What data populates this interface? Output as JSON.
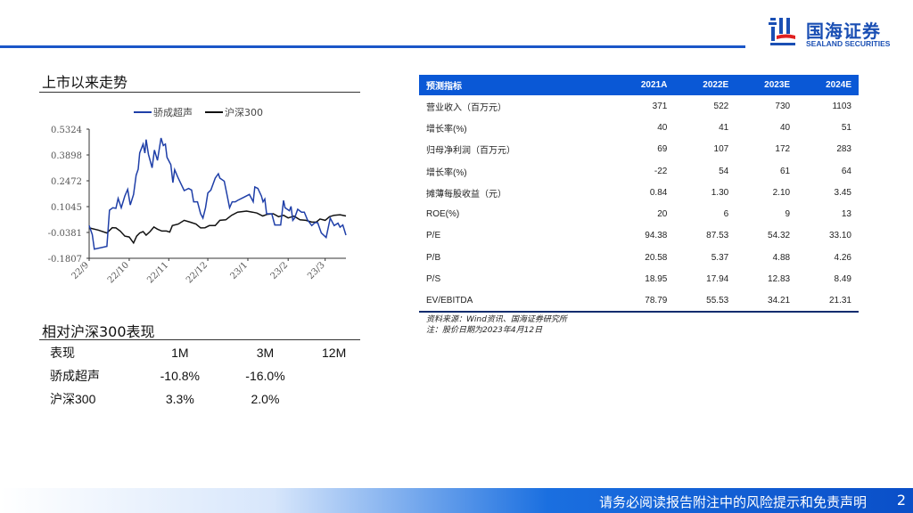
{
  "header": {
    "logo_cn": "国海证券",
    "logo_en": "SEALAND SECURITIES",
    "accent": "#1a56c8"
  },
  "trend": {
    "title": "上市以来走势"
  },
  "chart_data": {
    "type": "line",
    "title": "",
    "legend": [
      "骄成超声",
      "沪深300"
    ],
    "legend_position": "top",
    "yticks": [
      "0.5324",
      "0.3898",
      "0.2472",
      "0.1045",
      "-0.0381",
      "-0.1807"
    ],
    "ylim": [
      -0.1807,
      0.5324
    ],
    "xlim": [
      0,
      100
    ],
    "xticks": [
      {
        "label": "22/9",
        "t": 0
      },
      {
        "label": "22/10",
        "t": 15.6
      },
      {
        "label": "22/11",
        "t": 31
      },
      {
        "label": "22/12",
        "t": 46.2
      },
      {
        "label": "23/1",
        "t": 61.8
      },
      {
        "label": "23/2",
        "t": 77.5
      },
      {
        "label": "23/3",
        "t": 91.9
      }
    ],
    "series": [
      {
        "name": "骄成超声",
        "color": "#1f3fa8",
        "points": [
          [
            0,
            0
          ],
          [
            1.2,
            -0.05
          ],
          [
            2,
            -0.13
          ],
          [
            6.9,
            -0.115
          ],
          [
            7.9,
            0.085
          ],
          [
            9.2,
            0.098
          ],
          [
            10.4,
            0.095
          ],
          [
            11.3,
            0.15
          ],
          [
            12.5,
            0.098
          ],
          [
            13.9,
            0.163
          ],
          [
            15,
            0.2
          ],
          [
            16,
            0.114
          ],
          [
            17.3,
            0.172
          ],
          [
            18.3,
            0.278
          ],
          [
            19.1,
            0.311
          ],
          [
            19.7,
            0.401
          ],
          [
            21,
            0.45
          ],
          [
            21.7,
            0.4
          ],
          [
            22.2,
            0.475
          ],
          [
            23.1,
            0.393
          ],
          [
            24.5,
            0.319
          ],
          [
            25.4,
            0.417
          ],
          [
            26.6,
            0.36
          ],
          [
            28,
            0.483
          ],
          [
            28.9,
            0.442
          ],
          [
            29.7,
            0.45
          ],
          [
            30.3,
            0.377
          ],
          [
            31.8,
            0.336
          ],
          [
            32.6,
            0.237
          ],
          [
            33.3,
            0.308
          ],
          [
            34.7,
            0.262
          ],
          [
            35.8,
            0.229
          ],
          [
            37,
            0.193
          ],
          [
            38.7,
            0.205
          ],
          [
            39.9,
            0.196
          ],
          [
            40.7,
            0.131
          ],
          [
            42.2,
            0.131
          ],
          [
            43.4,
            0.065
          ],
          [
            44.3,
            0.041
          ],
          [
            45.3,
            0.098
          ],
          [
            46.2,
            0.18
          ],
          [
            47.4,
            0.196
          ],
          [
            49.1,
            0.262
          ],
          [
            50.3,
            0.286
          ],
          [
            50.9,
            0.262
          ],
          [
            52.6,
            0.245
          ],
          [
            53.8,
            0.163
          ],
          [
            54.7,
            0.098
          ],
          [
            55.7,
            0.131
          ],
          [
            56.9,
            0.131
          ],
          [
            57.8,
            0.139
          ],
          [
            60.1,
            0.155
          ],
          [
            62.4,
            0.172
          ],
          [
            63.9,
            0.131
          ],
          [
            64.5,
            0.213
          ],
          [
            65.7,
            0.205
          ],
          [
            67.1,
            0.163
          ],
          [
            67.7,
            0.131
          ],
          [
            68.4,
            0.147
          ],
          [
            69.1,
            0.065
          ],
          [
            71.1,
            0.065
          ],
          [
            72.3,
            0.003
          ],
          [
            74.6,
            0.003
          ],
          [
            75.7,
            0.139
          ],
          [
            76.3,
            0.098
          ],
          [
            78,
            0.082
          ],
          [
            78.6,
            0.106
          ],
          [
            79.3,
            0.029
          ],
          [
            80,
            0.041
          ],
          [
            81.2,
            0.09
          ],
          [
            82.7,
            0.074
          ],
          [
            83.8,
            0.074
          ],
          [
            85,
            0.032
          ],
          [
            86.7,
            0
          ],
          [
            87.9,
            0.016
          ],
          [
            89,
            0.016
          ],
          [
            90.4,
            -0.041
          ],
          [
            92.3,
            -0.066
          ],
          [
            93.9,
            0.041
          ],
          [
            95.4,
            0
          ],
          [
            96.9,
            0.013
          ],
          [
            97.7,
            -0.009
          ],
          [
            98.8,
            0.003
          ],
          [
            100,
            -0.053
          ]
        ]
      },
      {
        "name": "沪深300",
        "color": "#111111",
        "points": [
          [
            0,
            -0.013
          ],
          [
            3.5,
            -0.025
          ],
          [
            6.9,
            -0.041
          ],
          [
            9,
            -0.012
          ],
          [
            10.4,
            -0.013
          ],
          [
            12.1,
            -0.03
          ],
          [
            13.9,
            -0.058
          ],
          [
            15.6,
            -0.063
          ],
          [
            17.3,
            -0.096
          ],
          [
            18.5,
            -0.058
          ],
          [
            19.7,
            -0.041
          ],
          [
            21,
            -0.033
          ],
          [
            22.2,
            -0.053
          ],
          [
            23.7,
            -0.033
          ],
          [
            25.2,
            -0.008
          ],
          [
            26.6,
            -0.02
          ],
          [
            28.3,
            -0.03
          ],
          [
            30.1,
            -0.03
          ],
          [
            31.4,
            -0.036
          ],
          [
            32.4,
            0
          ],
          [
            34.7,
            0.008
          ],
          [
            37,
            0.029
          ],
          [
            39.3,
            0.019
          ],
          [
            41.6,
            0.008
          ],
          [
            43.4,
            -0.013
          ],
          [
            45.1,
            -0.012
          ],
          [
            46.8,
            0
          ],
          [
            49.1,
            0
          ],
          [
            50.9,
            0.029
          ],
          [
            53.2,
            0.032
          ],
          [
            55.5,
            0.057
          ],
          [
            57.8,
            0.074
          ],
          [
            61.3,
            0.08
          ],
          [
            63.6,
            0.074
          ],
          [
            65.3,
            0.069
          ],
          [
            67.6,
            0.053
          ],
          [
            69.4,
            0.062
          ],
          [
            71.7,
            0.065
          ],
          [
            73.8,
            0.049
          ],
          [
            75.7,
            0.057
          ],
          [
            77.5,
            0.042
          ],
          [
            79.8,
            0.052
          ],
          [
            82.1,
            0.032
          ],
          [
            84.4,
            0.029
          ],
          [
            86.7,
            0.019
          ],
          [
            88.4,
            0.019
          ],
          [
            89.9,
            0.036
          ],
          [
            91.9,
            0.029
          ],
          [
            93.6,
            0.049
          ],
          [
            95.4,
            0.057
          ],
          [
            97.7,
            0.06
          ],
          [
            100,
            0.053
          ]
        ]
      }
    ]
  },
  "forecast": {
    "headers": [
      "预测指标",
      "2021A",
      "2022E",
      "2023E",
      "2024E"
    ],
    "rows": [
      [
        "营业收入（百万元）",
        "371",
        "522",
        "730",
        "1103"
      ],
      [
        "增长率(%)",
        "40",
        "41",
        "40",
        "51"
      ],
      [
        "归母净利润（百万元）",
        "69",
        "107",
        "172",
        "283"
      ],
      [
        "增长率(%)",
        "-22",
        "54",
        "61",
        "64"
      ],
      [
        "摊薄每股收益（元）",
        "0.84",
        "1.30",
        "2.10",
        "3.45"
      ],
      [
        "ROE(%)",
        "20",
        "6",
        "9",
        "13"
      ],
      [
        "P/E",
        "94.38",
        "87.53",
        "54.32",
        "33.10"
      ],
      [
        "P/B",
        "20.58",
        "5.37",
        "4.88",
        "4.26"
      ],
      [
        "P/S",
        "18.95",
        "17.94",
        "12.83",
        "8.49"
      ],
      [
        "EV/EBITDA",
        "78.79",
        "55.53",
        "34.21",
        "21.31"
      ]
    ],
    "source": "资料来源：Wind资讯、国海证券研究所",
    "note": "注：股价日期为2023年4月12日"
  },
  "perf": {
    "title": "相对沪深300表现",
    "rows": [
      [
        "表现",
        "1M",
        "3M",
        "12M"
      ],
      [
        "骄成超声",
        "-10.8%",
        "-16.0%",
        ""
      ],
      [
        "沪深300",
        "3.3%",
        "2.0%",
        ""
      ]
    ]
  },
  "footer": {
    "disclaimer": "请务必阅读报告附注中的风险提示和免责声明",
    "page": "2"
  }
}
